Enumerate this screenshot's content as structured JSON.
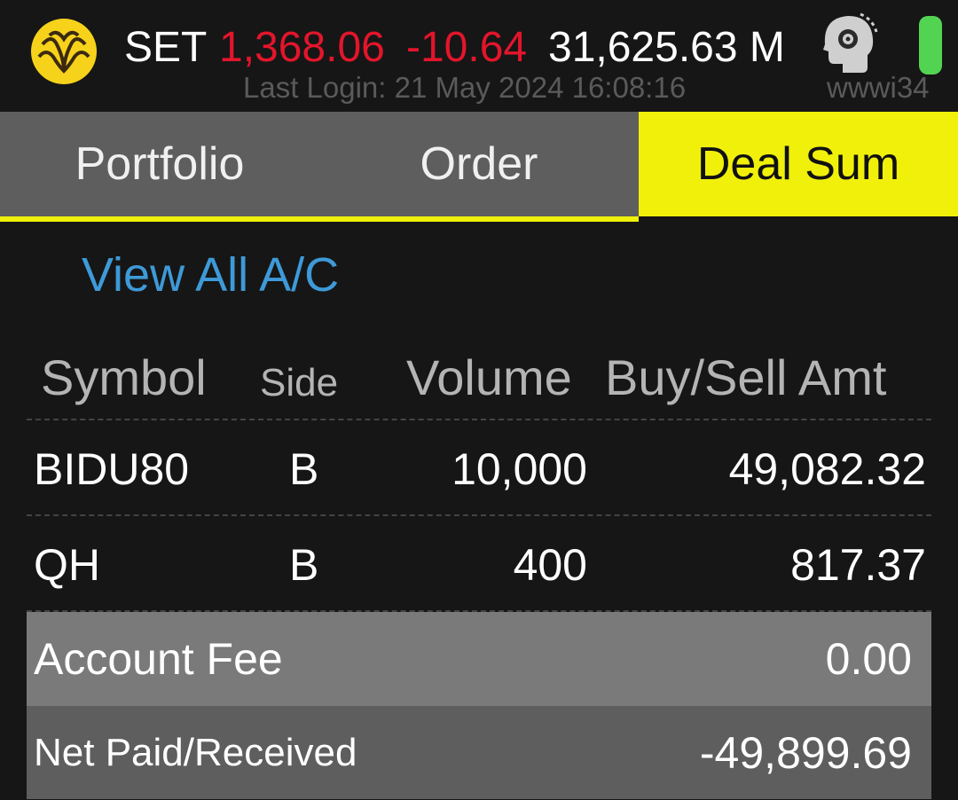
{
  "header": {
    "logo": "krungsri-logo",
    "index_name": "SET",
    "index_value": "1,368.06",
    "index_change": "-10.64",
    "market_value": "31,625.63 M",
    "last_login": "Last Login: 21 May 2024 16:08:16",
    "user_id": "wwwi34",
    "profile_icon": "head-gear-icon",
    "status_icon": "battery-icon",
    "colors": {
      "down": "#e3152b",
      "accent": "#f0f00a",
      "link": "#3e9ad8",
      "status": "#52d452"
    }
  },
  "tabs": [
    {
      "label": "Portfolio",
      "active": false
    },
    {
      "label": "Order",
      "active": false
    },
    {
      "label": "Deal Sum",
      "active": true
    }
  ],
  "view_all_label": "View All A/C",
  "table": {
    "columns": [
      "Symbol",
      "Side",
      "Volume",
      "Buy/Sell Amt"
    ],
    "rows": [
      {
        "symbol": "BIDU80",
        "side": "B",
        "volume": "10,000",
        "amount": "49,082.32"
      },
      {
        "symbol": "QH",
        "side": "B",
        "volume": "400",
        "amount": "817.37"
      }
    ]
  },
  "summary": {
    "fee_label": "Account Fee",
    "fee_value": "0.00",
    "net_label": "Net Paid/Received",
    "net_value": "-49,899.69"
  }
}
